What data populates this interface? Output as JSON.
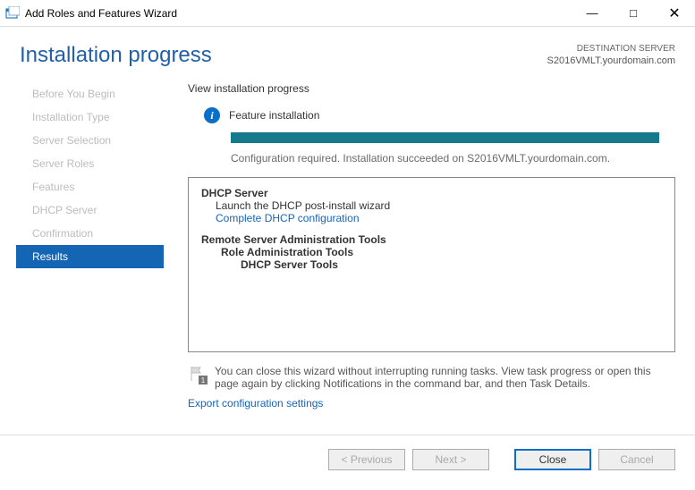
{
  "window": {
    "title": "Add Roles and Features Wizard"
  },
  "header": {
    "page_title": "Installation progress",
    "destination_label": "DESTINATION SERVER",
    "destination_server": "S2016VMLT.yourdomain.com"
  },
  "nav": {
    "items": [
      {
        "label": "Before You Begin"
      },
      {
        "label": "Installation Type"
      },
      {
        "label": "Server Selection"
      },
      {
        "label": "Server Roles"
      },
      {
        "label": "Features"
      },
      {
        "label": "DHCP Server"
      },
      {
        "label": "Confirmation"
      },
      {
        "label": "Results"
      }
    ]
  },
  "content": {
    "section_title": "View installation progress",
    "status_title": "Feature installation",
    "status_text": "Configuration required. Installation succeeded on S2016VMLT.yourdomain.com.",
    "results": {
      "dhcp_server": "DHCP Server",
      "dhcp_launch": "Launch the DHCP post-install wizard",
      "dhcp_link": "Complete DHCP configuration",
      "rsat": "Remote Server Administration Tools",
      "role_admin": "Role Administration Tools",
      "dhcp_tools": "DHCP Server Tools"
    },
    "note": "You can close this wizard without interrupting running tasks. View task progress or open this page again by clicking Notifications in the command bar, and then Task Details.",
    "note_badge": "1",
    "export_link": "Export configuration settings"
  },
  "footer": {
    "previous": "< Previous",
    "next": "Next >",
    "close": "Close",
    "cancel": "Cancel"
  }
}
